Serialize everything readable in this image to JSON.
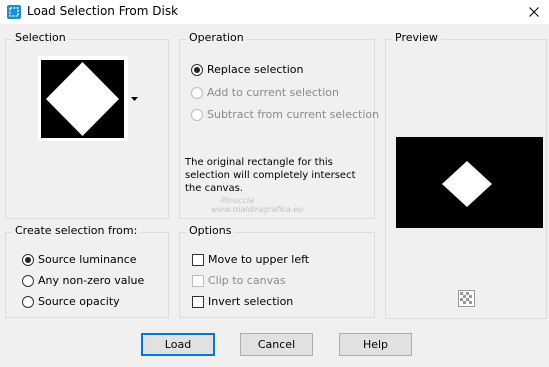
{
  "window": {
    "title": "Load Selection From Disk"
  },
  "selection": {
    "title": "Selection"
  },
  "operation": {
    "title": "Operation",
    "options": [
      "Replace selection",
      "Add to current selection",
      "Subtract from current selection"
    ],
    "selected": "Replace selection",
    "note": "The original rectangle for this selection will completely intersect the canvas."
  },
  "preview": {
    "title": "Preview"
  },
  "create_from": {
    "title": "Create selection from:",
    "options": [
      "Source luminance",
      "Any non-zero value",
      "Source opacity"
    ],
    "selected": "Source luminance"
  },
  "options_group": {
    "title": "Options",
    "items": [
      {
        "label": "Move to upper left",
        "checked": false,
        "enabled": true
      },
      {
        "label": "Clip to canvas",
        "checked": false,
        "enabled": false
      },
      {
        "label": "Invert selection",
        "checked": false,
        "enabled": true
      }
    ]
  },
  "buttons": {
    "load": "Load",
    "cancel": "Cancel",
    "help": "Help"
  },
  "watermark": {
    "line1": "Pinuccia",
    "line2": "www.maldiragrafica.eu"
  },
  "colors": {
    "accent": "#0078d7",
    "background": "#f0f0f0",
    "title_bar": "#ffffff",
    "icon": "#1a8fd6"
  },
  "icons": {
    "app": "selection-icon",
    "close": "close-icon",
    "dropdown": "caret-down-icon",
    "preview_toggle": "checkerboard-icon"
  }
}
